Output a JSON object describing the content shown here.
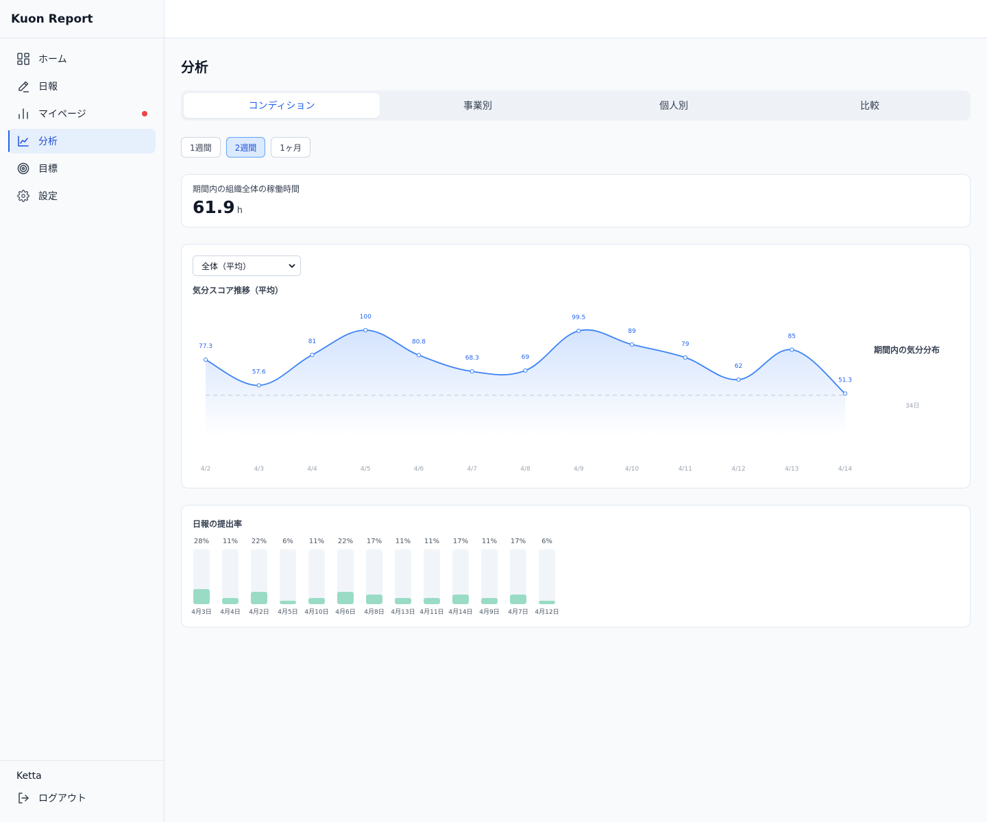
{
  "app": {
    "title": "Kuon Report"
  },
  "sidebar": {
    "items": [
      {
        "label": "ホーム",
        "icon": "grid-icon"
      },
      {
        "label": "日報",
        "icon": "pencil-icon"
      },
      {
        "label": "マイページ",
        "icon": "bar-chart-icon",
        "has_notification": true
      },
      {
        "label": "分析",
        "icon": "line-chart-icon",
        "active": true
      },
      {
        "label": "目標",
        "icon": "target-icon"
      },
      {
        "label": "設定",
        "icon": "gear-icon"
      }
    ],
    "user": "Ketta",
    "logout_label": "ログアウト"
  },
  "page": {
    "title": "分析"
  },
  "tabs": [
    {
      "label": "コンディション",
      "active": true
    },
    {
      "label": "事業別"
    },
    {
      "label": "個人別"
    },
    {
      "label": "比較"
    }
  ],
  "periods": [
    {
      "label": "1週間"
    },
    {
      "label": "2週間",
      "active": true
    },
    {
      "label": "1ヶ月"
    }
  ],
  "summary": {
    "label": "期間内の組織全体の稼働時間",
    "value": "61.9",
    "unit": "h"
  },
  "mood": {
    "select_value": "全体（平均）",
    "distribution_title": "期間内の気分分布",
    "distribution_value": "34日"
  },
  "chart_data": [
    {
      "type": "area",
      "title": "気分スコア推移（平均）",
      "categories": [
        "4/2",
        "4/3",
        "4/4",
        "4/5",
        "4/6",
        "4/7",
        "4/8",
        "4/9",
        "4/10",
        "4/11",
        "4/12",
        "4/13",
        "4/14"
      ],
      "values": [
        77.3,
        57.6,
        81,
        100,
        80.8,
        68.3,
        69,
        99.5,
        89,
        79,
        62,
        85,
        51.3
      ],
      "line_color": "#3b82f6",
      "grid": false
    },
    {
      "type": "bar",
      "title": "日報の提出率",
      "categories": [
        "4月3日",
        "4月4日",
        "4月2日",
        "4月5日",
        "4月10日",
        "4月6日",
        "4月8日",
        "4月13日",
        "4月11日",
        "4月14日",
        "4月9日",
        "4月7日",
        "4月12日"
      ],
      "values": [
        28,
        11,
        22,
        6,
        11,
        22,
        17,
        11,
        11,
        17,
        11,
        17,
        6
      ],
      "labels": [
        "28%",
        "11%",
        "22%",
        "6%",
        "11%",
        "22%",
        "17%",
        "11%",
        "11%",
        "17%",
        "11%",
        "17%",
        "6%"
      ],
      "unit": "%",
      "bar_color": "#99dbc5",
      "grid": false
    }
  ]
}
